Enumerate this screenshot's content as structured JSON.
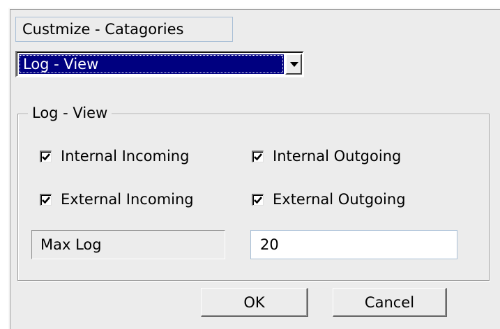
{
  "dialog": {
    "title": "Custmize - Catagories",
    "category_select": {
      "value": "Log - View"
    },
    "group": {
      "legend": "Log - View",
      "checkboxes": [
        {
          "label": "Internal Incoming",
          "checked": true
        },
        {
          "label": "Internal Outgoing",
          "checked": true
        },
        {
          "label": "External Incoming",
          "checked": true
        },
        {
          "label": "External Outgoing",
          "checked": true
        }
      ],
      "max_log": {
        "label": "Max Log",
        "value": "20"
      }
    },
    "buttons": {
      "ok": "OK",
      "cancel": "Cancel"
    }
  },
  "colors": {
    "dialog_bg": "#ececec",
    "selection_bg": "#000080",
    "selection_text": "#ffffff",
    "focus_border": "#a9bfd6"
  },
  "icons": {
    "checkbox_mark": "checkmark-icon",
    "combo_arrow": "chevron-down-icon"
  }
}
